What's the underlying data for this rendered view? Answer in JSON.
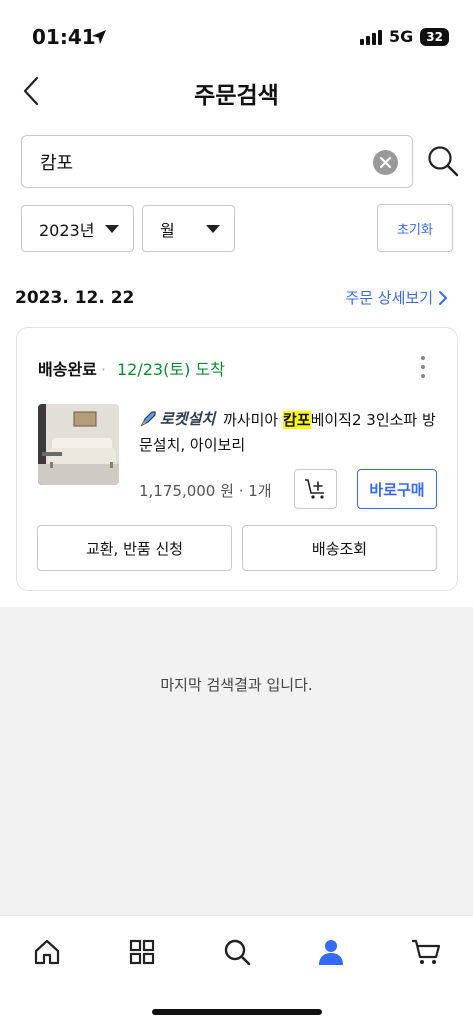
{
  "status_bar": {
    "time": "01:41",
    "network": "5G",
    "battery": "32"
  },
  "header": {
    "title": "주문검색"
  },
  "search": {
    "value": "캄포",
    "placeholder": ""
  },
  "filters": {
    "year": "2023년",
    "month": "월",
    "reset_label": "초기화"
  },
  "order": {
    "date": "2023. 12. 22",
    "detail_link": "주문 상세보기",
    "status": "배송완료",
    "separator": "·",
    "arrival": "12/23(토) 도착",
    "badge": "로켓설치",
    "product_name_before": "까사미아 ",
    "product_name_highlight": "캄포",
    "product_name_after": "베이직2 3인소파 방문설치, 아이보리",
    "price": "1,175,000 원",
    "quantity": "1개",
    "buy_label": "바로구매",
    "return_label": "교환, 반품 신청",
    "tracking_label": "배송조회"
  },
  "end_message": "마지막 검색결과 입니다.",
  "bottom_nav": {
    "items": [
      {
        "icon": "home-icon"
      },
      {
        "icon": "category-grid-icon"
      },
      {
        "icon": "search-icon"
      },
      {
        "icon": "user-icon"
      },
      {
        "icon": "cart-icon"
      }
    ]
  },
  "colors": {
    "accent": "#346aff",
    "delivered": "#0a8f2e",
    "highlight": "#ffff00"
  }
}
